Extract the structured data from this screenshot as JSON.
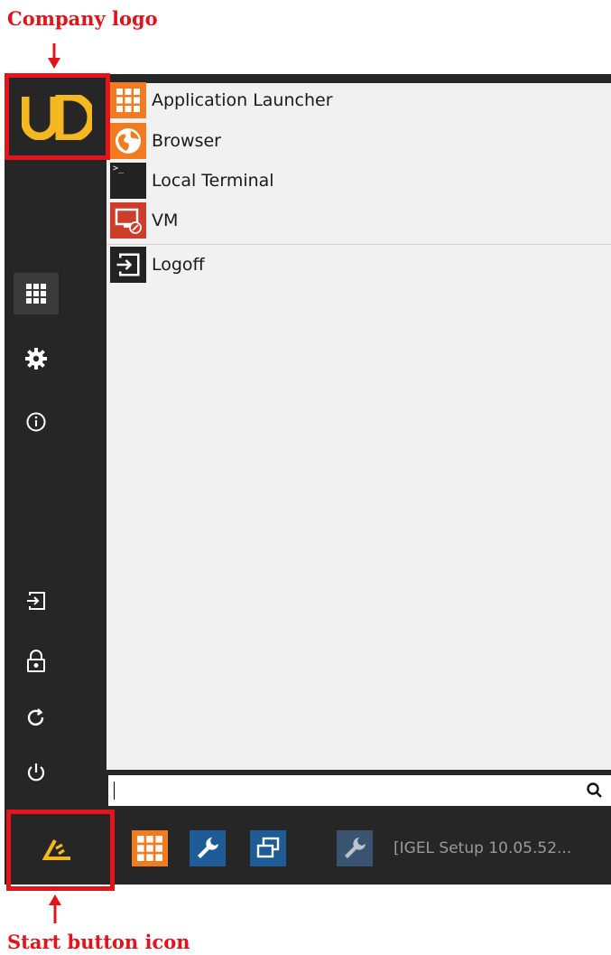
{
  "annotations": {
    "company_logo": "Company logo",
    "start_button_icon": "Start button icon"
  },
  "menu": {
    "items": [
      {
        "label": "Application Launcher",
        "icon": "app-launcher-grid-icon"
      },
      {
        "label": "Browser",
        "icon": "globe-icon"
      },
      {
        "label": "Local Terminal",
        "icon": "terminal-icon"
      },
      {
        "label": "VM",
        "icon": "vm-monitor-icon"
      },
      {
        "label": "Logoff",
        "icon": "logoff-icon"
      }
    ]
  },
  "sidebar": {
    "logo": "UD",
    "buttons": [
      "grid-icon",
      "gear-icon",
      "info-icon",
      "logout-icon",
      "lock-icon",
      "refresh-icon",
      "power-icon"
    ]
  },
  "search": {
    "value": "",
    "icon": "search-icon"
  },
  "taskbar": {
    "window_title": "[IGEL Setup 10.05.52..."
  },
  "colors": {
    "brand_yellow": "#f4b820",
    "dark": "#262626",
    "orange": "#f07b21",
    "blue": "#1e5c98",
    "red_annotation": "#e1141b"
  }
}
